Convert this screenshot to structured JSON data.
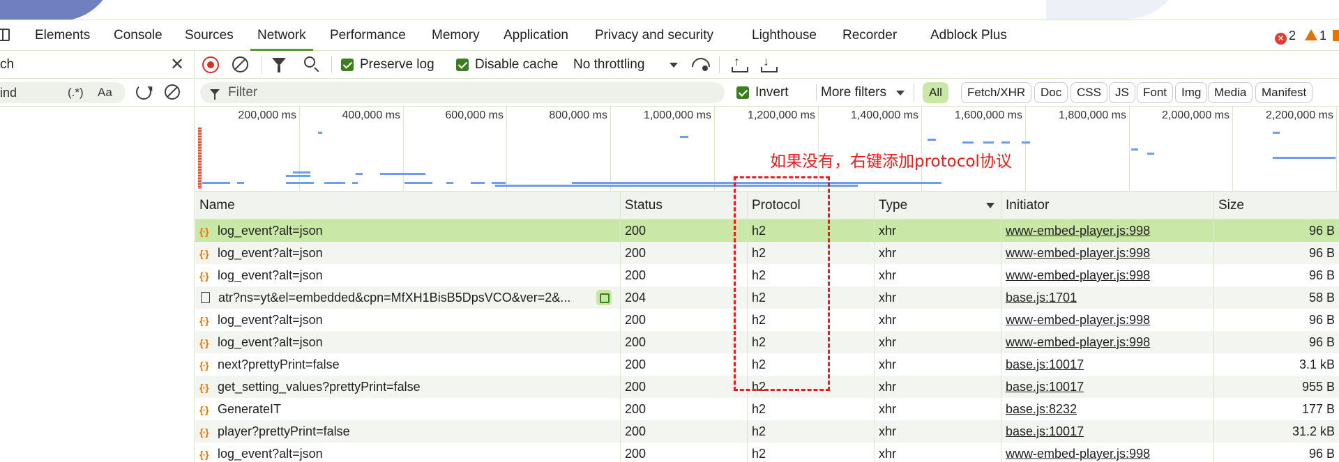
{
  "tabs": [
    {
      "label": "Elements",
      "active": false
    },
    {
      "label": "Console",
      "active": false
    },
    {
      "label": "Sources",
      "active": false
    },
    {
      "label": "Network",
      "active": true
    },
    {
      "label": "Performance",
      "active": false
    },
    {
      "label": "Memory",
      "active": false
    },
    {
      "label": "Application",
      "active": false
    },
    {
      "label": "Privacy and security",
      "active": false
    },
    {
      "label": "Lighthouse",
      "active": false
    },
    {
      "label": "Recorder",
      "active": false
    },
    {
      "label": "Adblock Plus",
      "active": false
    }
  ],
  "status": {
    "errors": "2",
    "warnings": "1"
  },
  "search_panel": {
    "title": "ch",
    "placeholder": "ind",
    "regex_label": "(.*)",
    "case_label": "Aa"
  },
  "toolbar": {
    "preserve_log": "Preserve log",
    "disable_cache": "Disable cache",
    "throttling": "No throttling"
  },
  "filter": {
    "placeholder": "Filter",
    "invert": "Invert",
    "more_filters": "More filters",
    "types": [
      "All",
      "Fetch/XHR",
      "Doc",
      "CSS",
      "JS",
      "Font",
      "Img",
      "Media",
      "Manifest"
    ]
  },
  "timeline": {
    "ticks": [
      "200,000 ms",
      "400,000 ms",
      "600,000 ms",
      "800,000 ms",
      "1,000,000 ms",
      "1,200,000 ms",
      "1,400,000 ms",
      "1,600,000 ms",
      "1,800,000 ms",
      "2,000,000 ms",
      "2,200,000 ms"
    ]
  },
  "annotation": "如果没有，右键添加protocol协议",
  "columns": {
    "name": "Name",
    "status": "Status",
    "protocol": "Protocol",
    "type": "Type",
    "initiator": "Initiator",
    "size": "Size"
  },
  "rows": [
    {
      "icon": "xhr",
      "name": "log_event?alt=json",
      "status": "200",
      "protocol": "h2",
      "type": "xhr",
      "initiator": "www-embed-player.js:998",
      "size": "96 B"
    },
    {
      "icon": "xhr",
      "name": "log_event?alt=json",
      "status": "200",
      "protocol": "h2",
      "type": "xhr",
      "initiator": "www-embed-player.js:998",
      "size": "96 B"
    },
    {
      "icon": "xhr",
      "name": "log_event?alt=json",
      "status": "200",
      "protocol": "h2",
      "type": "xhr",
      "initiator": "www-embed-player.js:998",
      "size": "96 B"
    },
    {
      "icon": "doc",
      "name": "atr?ns=yt&el=embedded&cpn=MfXH1BisB5DpsVCO&ver=2&...",
      "status": "204",
      "protocol": "h2",
      "type": "xhr",
      "initiator": "base.js:1701",
      "size": "58 B"
    },
    {
      "icon": "xhr",
      "name": "log_event?alt=json",
      "status": "200",
      "protocol": "h2",
      "type": "xhr",
      "initiator": "www-embed-player.js:998",
      "size": "96 B"
    },
    {
      "icon": "xhr",
      "name": "log_event?alt=json",
      "status": "200",
      "protocol": "h2",
      "type": "xhr",
      "initiator": "www-embed-player.js:998",
      "size": "96 B"
    },
    {
      "icon": "xhr",
      "name": "next?prettyPrint=false",
      "status": "200",
      "protocol": "h2",
      "type": "xhr",
      "initiator": "base.js:10017",
      "size": "3.1 kB"
    },
    {
      "icon": "xhr",
      "name": "get_setting_values?prettyPrint=false",
      "status": "200",
      "protocol": "h2",
      "type": "xhr",
      "initiator": "base.js:10017",
      "size": "955 B"
    },
    {
      "icon": "xhr",
      "name": "GenerateIT",
      "status": "200",
      "protocol": "h2",
      "type": "xhr",
      "initiator": "base.js:8232",
      "size": "177 B"
    },
    {
      "icon": "xhr",
      "name": "player?prettyPrint=false",
      "status": "200",
      "protocol": "h2",
      "type": "xhr",
      "initiator": "base.js:10017",
      "size": "31.2 kB"
    },
    {
      "icon": "xhr",
      "name": "log_event?alt=json",
      "status": "200",
      "protocol": "h2",
      "type": "xhr",
      "initiator": "www-embed-player.js:998",
      "size": "96 B"
    }
  ]
}
